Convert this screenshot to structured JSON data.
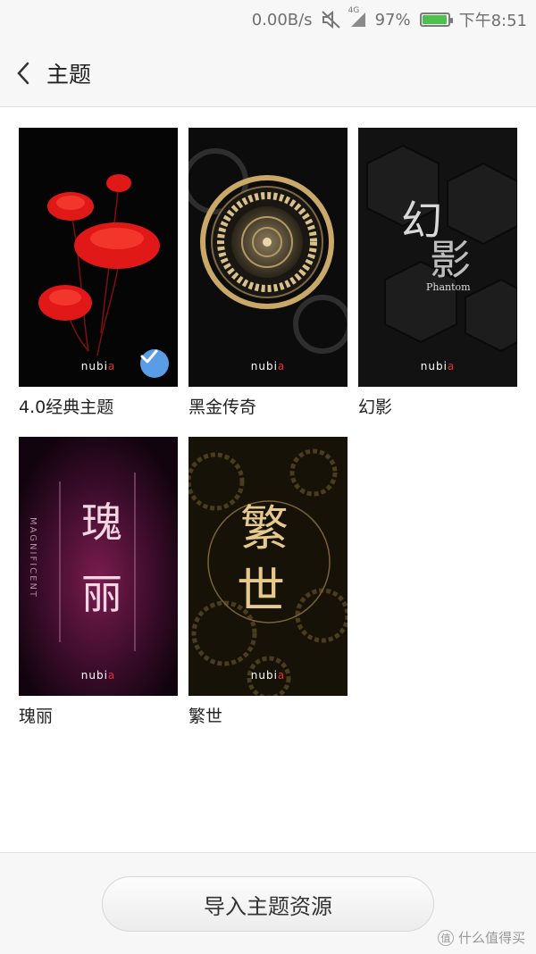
{
  "status": {
    "speed": "0.00B/s",
    "net_label": "4G",
    "battery": "97%",
    "battery_level": 0.97,
    "time": "下午8:51"
  },
  "header": {
    "title": "主题"
  },
  "themes": [
    {
      "label": "4.0经典主题",
      "selected": true,
      "logo_a": "nubi",
      "logo_b": "a"
    },
    {
      "label": "黑金传奇",
      "selected": false,
      "logo_a": "nubi",
      "logo_b": "a"
    },
    {
      "label": "幻影",
      "selected": false,
      "art_text_1": "幻",
      "art_text_2": "影",
      "art_sub": "Phantom",
      "logo_a": "nubi",
      "logo_b": "a"
    },
    {
      "label": "瑰丽",
      "selected": false,
      "art_text_1": "瑰",
      "art_text_2": "丽",
      "art_sub": "MAGNIFICENT",
      "logo_a": "nubi",
      "logo_b": "a"
    },
    {
      "label": "繁世",
      "selected": false,
      "art_text_1": "繁",
      "art_text_2": "世",
      "logo_a": "nubi",
      "logo_b": "a"
    }
  ],
  "footer": {
    "import_label": "导入主题资源"
  },
  "watermark": {
    "icon": "值",
    "text": "什么值得买"
  },
  "colors": {
    "accent": "#5b9ce6",
    "battery": "#4cc24c"
  }
}
